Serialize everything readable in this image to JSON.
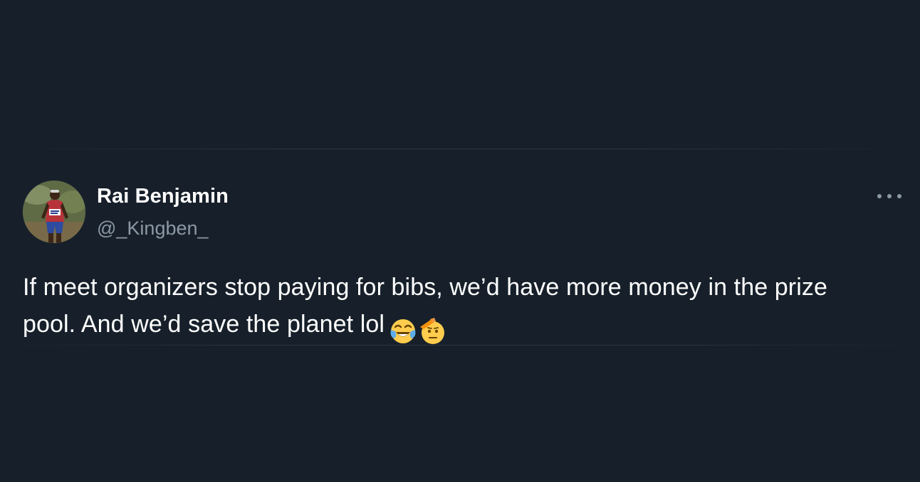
{
  "tweet": {
    "author": {
      "display_name": "Rai Benjamin",
      "handle": "@_Kingben_"
    },
    "text": "If meet organizers stop paying for bibs, we’d have more money in the prize pool. And we’d save the planet lol",
    "emojis": [
      "face-with-tears-of-joy",
      "saluting-face"
    ]
  },
  "colors": {
    "background": "#17202a",
    "text_primary": "#ffffff",
    "text_secondary": "#8b98a5"
  }
}
